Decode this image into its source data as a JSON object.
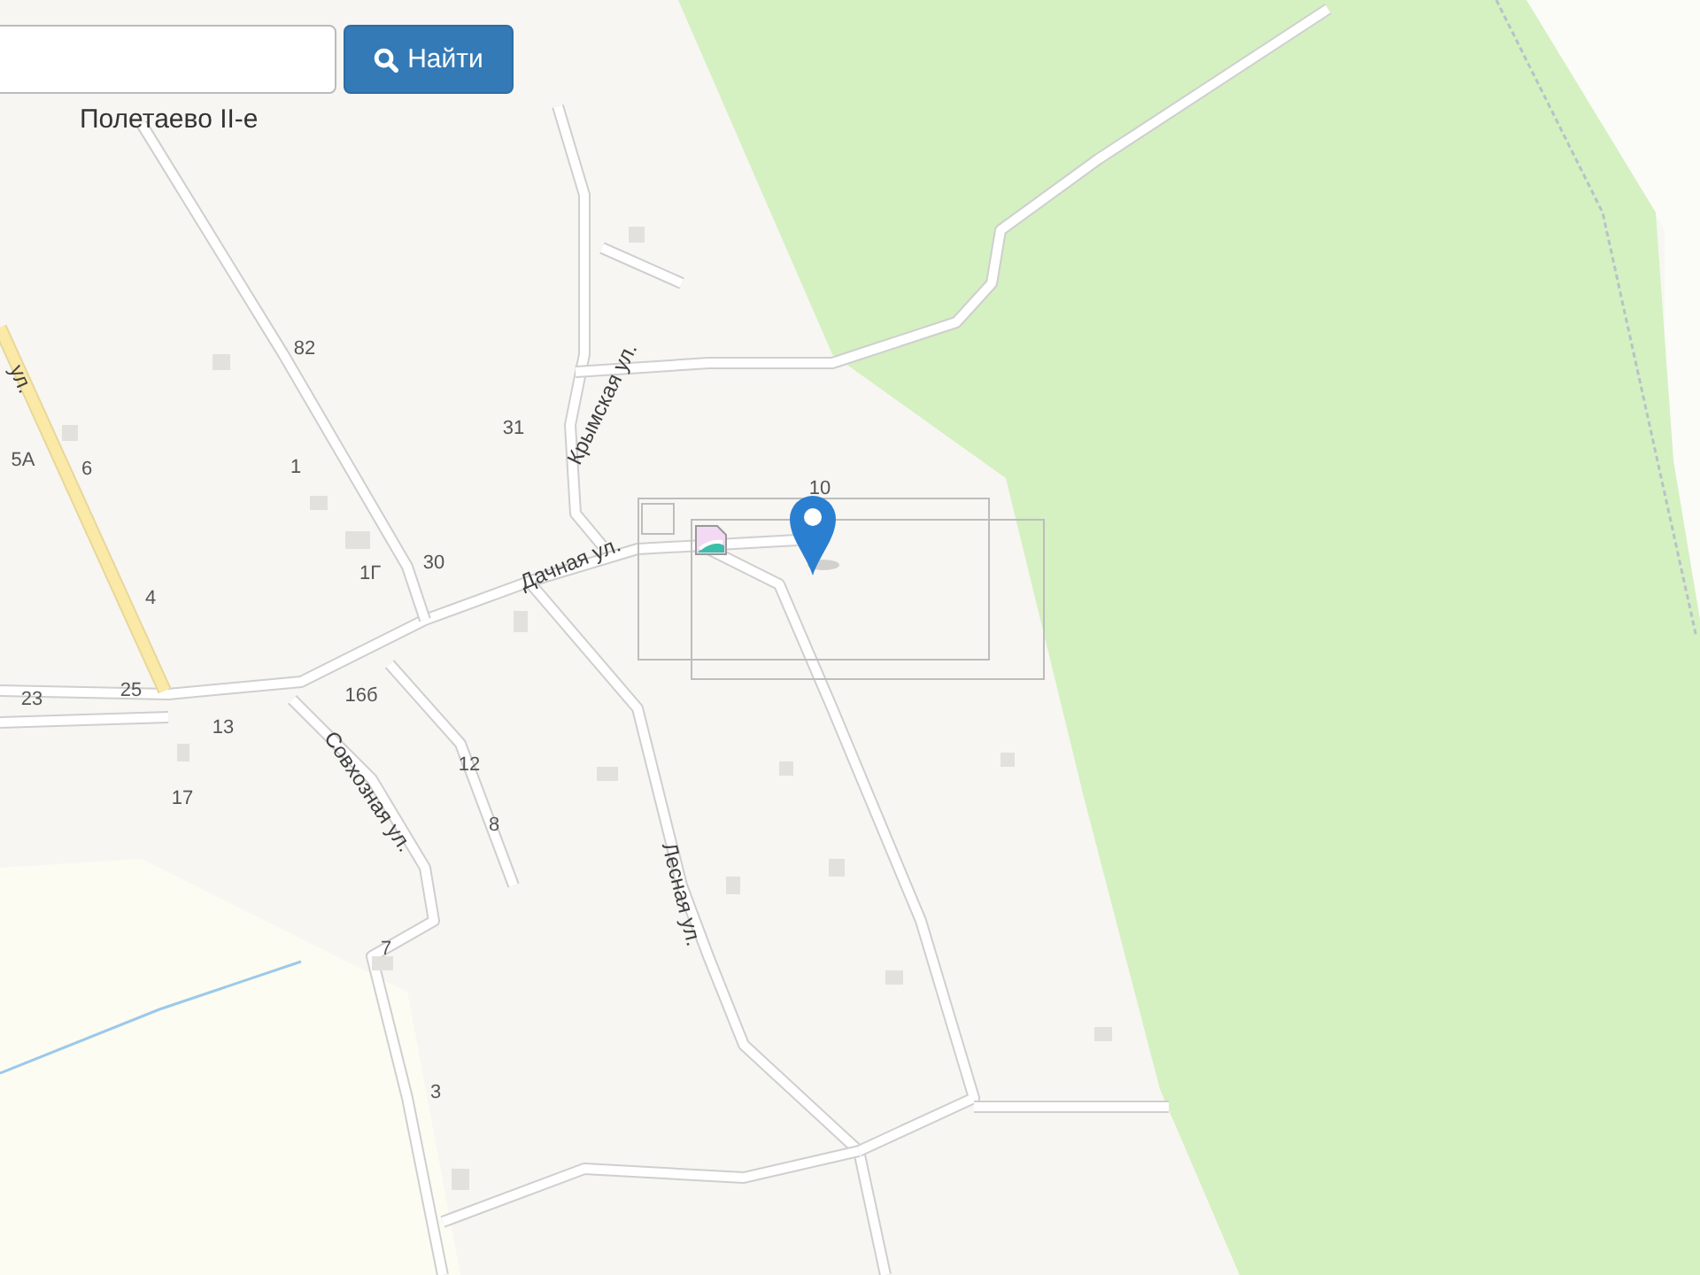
{
  "search": {
    "button": "Найти"
  },
  "place_label": "Полетаево II-е",
  "streets": [
    {
      "name": "ул."
    },
    {
      "name": "Крымская ул."
    },
    {
      "name": "Дачная ул."
    },
    {
      "name": "Совхозная ул."
    },
    {
      "name": "Лесная ул."
    }
  ],
  "house_numbers": [
    "82",
    "31",
    "5А",
    "6",
    "1",
    "10",
    "1Г",
    "30",
    "4",
    "23",
    "25",
    "16б",
    "13",
    "12",
    "17",
    "8",
    "7",
    "3"
  ]
}
